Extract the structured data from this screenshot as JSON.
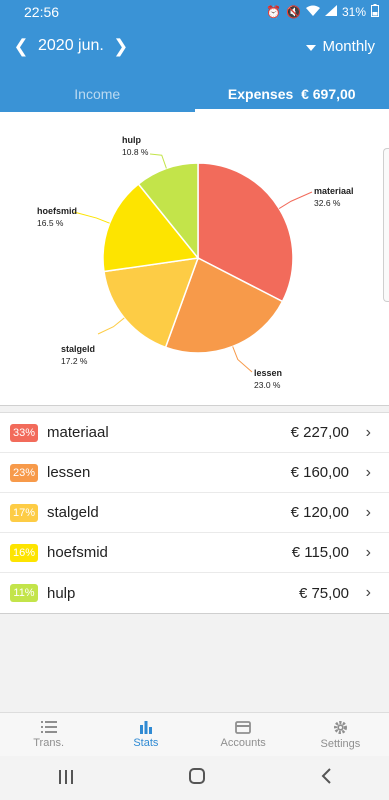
{
  "status_bar": {
    "time": "22:56",
    "battery": "31%"
  },
  "header": {
    "period": "2020 jun.",
    "view_mode": "Monthly"
  },
  "tabs": [
    {
      "label": "Income",
      "active": false
    },
    {
      "label": "Expenses  € 697,00",
      "active": true
    }
  ],
  "chart_data": {
    "type": "pie",
    "slices": [
      {
        "label": "materiaal",
        "percent_label": "32.6 %",
        "value": 32.6,
        "color": "#f26b5b"
      },
      {
        "label": "lessen",
        "percent_label": "23.0 %",
        "value": 23.0,
        "color": "#f79a4a"
      },
      {
        "label": "stalgeld",
        "percent_label": "17.2 %",
        "value": 17.2,
        "color": "#fdcc45"
      },
      {
        "label": "hoefsmid",
        "percent_label": "16.5 %",
        "value": 16.5,
        "color": "#fde400"
      },
      {
        "label": "hulp",
        "percent_label": "10.8 %",
        "value": 10.8,
        "color": "#c3e44a"
      }
    ]
  },
  "categories": [
    {
      "percent": "33%",
      "name": "materiaal",
      "amount": "€ 227,00",
      "color": "#f26b5b"
    },
    {
      "percent": "23%",
      "name": "lessen",
      "amount": "€ 160,00",
      "color": "#f79a4a"
    },
    {
      "percent": "17%",
      "name": "stalgeld",
      "amount": "€ 120,00",
      "color": "#fdcc45"
    },
    {
      "percent": "16%",
      "name": "hoefsmid",
      "amount": "€ 115,00",
      "color": "#fde400"
    },
    {
      "percent": "11%",
      "name": "hulp",
      "amount": "€ 75,00",
      "color": "#c3e44a"
    }
  ],
  "bottom_nav": [
    {
      "label": "Trans.",
      "icon": "list-icon",
      "active": false
    },
    {
      "label": "Stats",
      "icon": "bar-chart-icon",
      "active": true
    },
    {
      "label": "Accounts",
      "icon": "wallet-icon",
      "active": false
    },
    {
      "label": "Settings",
      "icon": "gear-icon",
      "active": false
    }
  ]
}
